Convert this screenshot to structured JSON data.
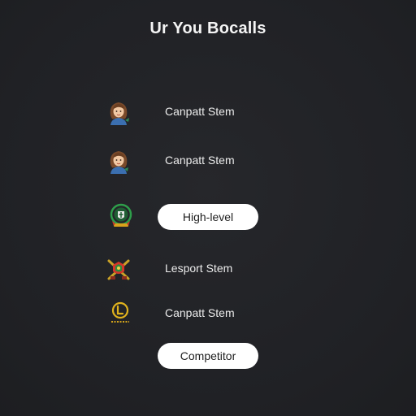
{
  "header": {
    "title": "Ur You Bocalls"
  },
  "rows": [
    {
      "icon": "woman-avatar-icon",
      "label": "Canpatt Stem"
    },
    {
      "icon": "woman-avatar-icon",
      "label": "Canpatt Stem"
    },
    {
      "icon": "green-shield-badge-icon",
      "button_label": "High-level"
    },
    {
      "icon": "crossed-swords-badge-icon",
      "label": "Lesport Stem"
    },
    {
      "icon": "gold-emblem-icon",
      "label": "Canpatt Stem"
    }
  ],
  "footer": {
    "button_label": "Competitor"
  },
  "colors": {
    "background": "#212226",
    "text": "#f2f2f2",
    "pill_bg": "#ffffff",
    "pill_text": "#1e1e1e"
  }
}
